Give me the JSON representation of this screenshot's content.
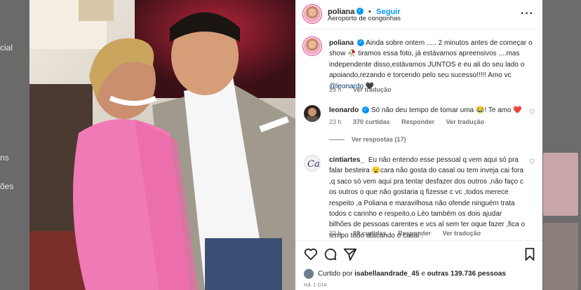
{
  "background": {
    "left_texts": [
      "cial",
      "ns",
      "ões"
    ],
    "colors": {
      "overlay": "#5b5b5b"
    }
  },
  "post": {
    "username": "poliana",
    "follow_label": "Seguir",
    "location": "Aeroporto de congonhas",
    "caption": {
      "username": "poliana",
      "text": "Ainda sobre ontem ..... 2 minutos antes de começar o show 🥀 tiramos essa foto, já estávamos apreensivos ....mas independente disso,estávamos JUNTOS e eu ali do seu lado o apoiando,rezando e torcendo pelo seu sucesso!!!!! Amo vc",
      "mention": "@leonardo",
      "end_emoji": "🖤",
      "time": "23 h",
      "translate": "Ver tradução"
    },
    "comments": [
      {
        "username": "leonardo",
        "text": "Só não deu tempo de tomar uma 😂! Te amo ❤️",
        "time": "23 h",
        "likes": "370 curtidas",
        "reply": "Responder",
        "translate": "Ver tradução",
        "view_replies": "Ver respostas (17)"
      },
      {
        "username": "cintiartes_",
        "text": "Eu não entendo esse pessoal q vem aqui só pra falar besteira 😦cara não gosta do casal ou tem inveja cai fora ,q saco só vem aqui pra tentar desfazer dos outros ,não faço c os outros o que não gostaria q fizesse c vc ,todos merece respeito ,a Poliana e maravilhosa não ofende ninguém trata todos c carinho e respeito,o Léo também os dois ajudar bilhões de pessoas carentes e vcs al sem ter oque fazer ,fica o tempo todo atacando o casal .",
        "time": "23 h",
        "likes": "98 curtidas",
        "reply": "Responder",
        "translate": "Ver tradução"
      }
    ],
    "liked_by": {
      "prefix": "Curtido por",
      "user": "isabellaandrade_45",
      "middle": "e",
      "others": "outras 139.736 pessoas"
    },
    "date": "HÁ 1 DIA",
    "colors": {
      "accent": "#0095f6",
      "text": "#262626",
      "secondary": "#737373",
      "heart_red": "#ed4956"
    },
    "icons": [
      "heart-icon",
      "comment-icon",
      "share-icon",
      "bookmark-icon",
      "more-icon",
      "verified-badge"
    ]
  }
}
